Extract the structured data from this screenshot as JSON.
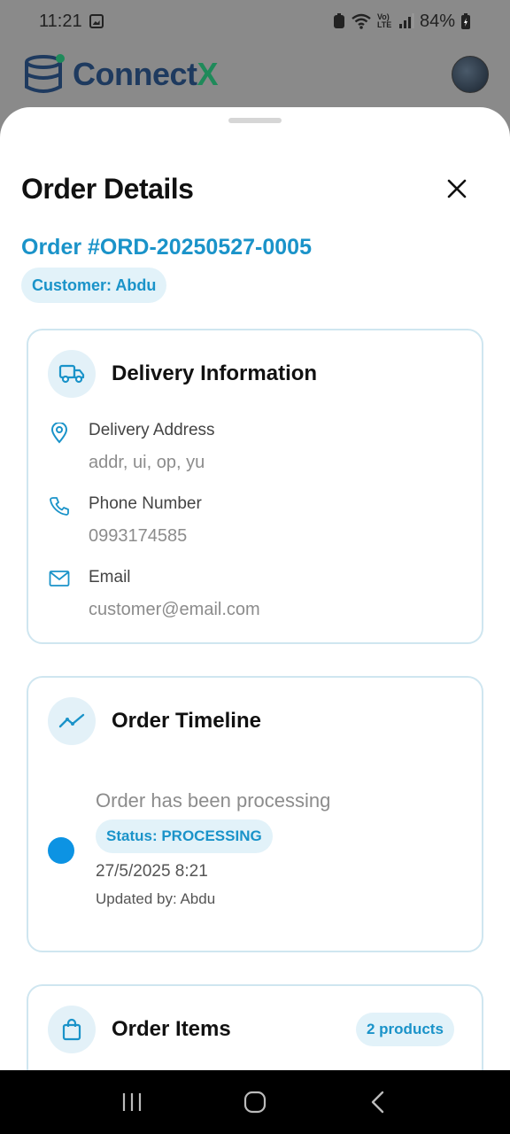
{
  "status_bar": {
    "time": "11:21",
    "battery": "84%",
    "network": "Vo) LTE"
  },
  "app": {
    "brand_main": "Connect",
    "brand_accent": "X"
  },
  "sheet": {
    "title": "Order Details",
    "order_id": "Order #ORD-20250527-0005",
    "customer_chip": "Customer: Abdu"
  },
  "delivery": {
    "title": "Delivery Information",
    "address_label": "Delivery Address",
    "address_value": "addr, ui, op, yu",
    "phone_label": "Phone Number",
    "phone_value": "0993174585",
    "email_label": "Email",
    "email_value": "customer@email.com"
  },
  "timeline": {
    "title": "Order Timeline",
    "entries": [
      {
        "description": "Order has been processing",
        "status": "Status: PROCESSING",
        "date": "27/5/2025 8:21",
        "updated_by": "Updated by: Abdu"
      }
    ]
  },
  "items": {
    "title": "Order Items",
    "count_badge": "2 products"
  },
  "colors": {
    "accent": "#1a93c9",
    "chip_bg": "#e2f2f9",
    "timeline_dot": "#0c93e3",
    "card_border": "#cfe6f0"
  }
}
